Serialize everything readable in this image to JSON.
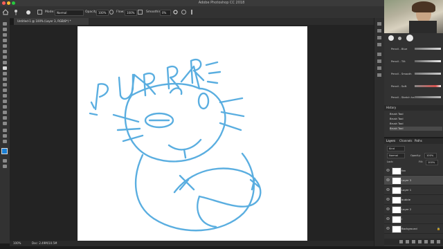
{
  "window": {
    "title": "Adobe Photoshop CC 2018"
  },
  "options": {
    "mode_label": "Mode:",
    "mode_value": "Normal",
    "opacity_label": "Opacity:",
    "opacity_value": "100%",
    "flow_label": "Flow:",
    "flow_value": "100%",
    "smoothing_label": "Smoothing:",
    "smoothing_value": "0%"
  },
  "document_tab": {
    "label": "Untitled-1 @ 100% (Layer 3, RGB/8*) *"
  },
  "canvas": {
    "doodle_text": "PURRR",
    "sketch_color": "#5aaee0"
  },
  "status": {
    "zoom": "100%",
    "doc_info": "Doc: 2.49M/10.5M"
  },
  "brushes": [
    {
      "name": "Pencil - Blue"
    },
    {
      "name": "Pencil - Tilt"
    },
    {
      "name": "Pencil - Smooth"
    },
    {
      "name": "Pencil - Soft"
    },
    {
      "name": "Pencil - Sketch hard"
    }
  ],
  "history": {
    "title": "History",
    "items": [
      "Brush Tool",
      "Brush Tool",
      "Brush Tool",
      "Brush Tool"
    ]
  },
  "layers_panel": {
    "tabs": [
      "Layers",
      "Channels",
      "Paths"
    ],
    "kind_value": "Kind",
    "blend_value": "Normal",
    "opacity_label": "Opacity:",
    "opacity_value": "100%",
    "lock_label": "Lock:",
    "fill_label": "Fill:",
    "fill_value": "100%",
    "layers": [
      {
        "name": "fan"
      },
      {
        "name": "Layer 3"
      },
      {
        "name": "Layer 1"
      },
      {
        "name": "bubble"
      },
      {
        "name": "Layer 2"
      },
      {
        "name": "l"
      },
      {
        "name": "Background"
      }
    ]
  },
  "colors": {
    "accent": "#5aaee0",
    "foreground": "#1a7fd4",
    "background": "#ffffff"
  }
}
